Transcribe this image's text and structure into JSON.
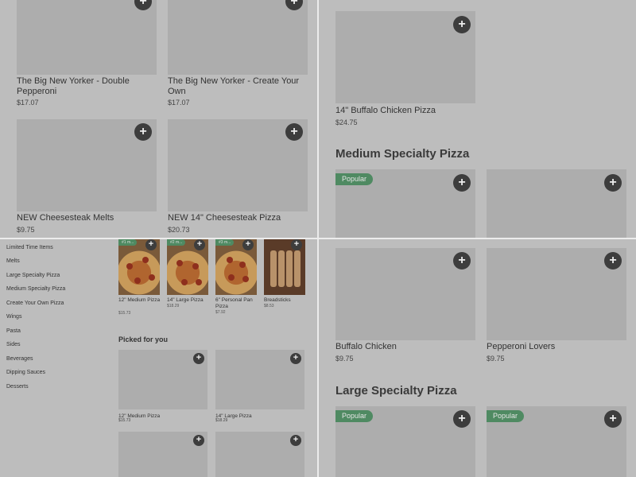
{
  "top_left": {
    "cards": [
      {
        "name": "The Big New Yorker - Double Pepperoni",
        "price": "$17.07"
      },
      {
        "name": "The Big New Yorker - Create Your Own",
        "price": "$17.07"
      },
      {
        "name": "NEW Cheesesteak Melts",
        "price": "$9.75"
      },
      {
        "name": "NEW 14\" Cheesesteak Pizza",
        "price": "$20.73"
      }
    ]
  },
  "top_right": {
    "card": {
      "name": "14\" Buffalo Chicken Pizza",
      "price": "$24.75"
    },
    "section_title": "Medium Specialty Pizza",
    "badge": "Popular"
  },
  "bottom_left": {
    "sidebar": [
      "Limited Time Items",
      "Melts",
      "Large Specialty Pizza",
      "Medium Specialty Pizza",
      "Create Your Own Pizza",
      "Wings",
      "Pasta",
      "Sides",
      "Beverages",
      "Dipping Sauces",
      "Desserts"
    ],
    "popular": [
      {
        "rank": "#1 m...",
        "name": "12\" Medium Pizza",
        "price": "$15.73"
      },
      {
        "rank": "#2 m...",
        "name": "14\" Large Pizza",
        "price": "$18.29"
      },
      {
        "rank": "#3 m...",
        "name": "6\" Personal Pan Pizza",
        "price": "$7.92"
      },
      {
        "rank": "",
        "name": "Breadsticks",
        "price": "$8.53"
      }
    ],
    "picked_title": "Picked for you",
    "picked": [
      {
        "name": "12\" Medium Pizza",
        "price": "$15.73"
      },
      {
        "name": "14\" Large Pizza",
        "price": "$18.29"
      }
    ]
  },
  "bottom_right": {
    "cards": [
      {
        "name": "Buffalo Chicken",
        "price": "$9.75"
      },
      {
        "name": "Pepperoni Lovers",
        "price": "$9.75"
      }
    ],
    "section_title": "Large Specialty Pizza",
    "badge": "Popular",
    "badge2": "Popular"
  },
  "icons": {
    "add": "+"
  },
  "colors": {
    "overlay": "#bdbdbd",
    "badge": "#4f8a62",
    "add_button": "#3d3d3d"
  }
}
